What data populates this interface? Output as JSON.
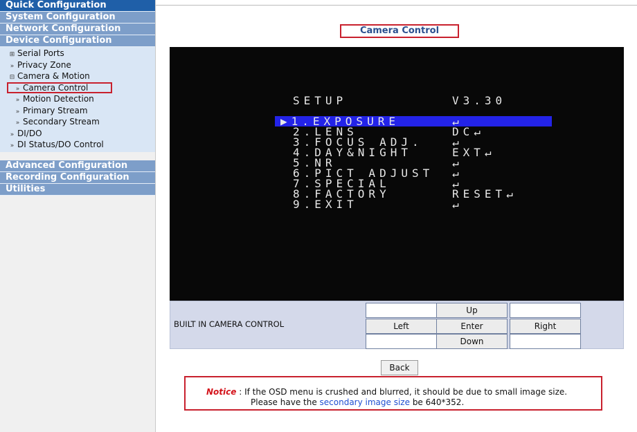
{
  "sidebar": {
    "sections_top": [
      {
        "label": "Quick Configuration"
      },
      {
        "label": "System Configuration"
      },
      {
        "label": "Network Configuration"
      },
      {
        "label": "Device Configuration"
      }
    ],
    "device_items": [
      {
        "label": "Serial Ports",
        "icon": "⊞"
      },
      {
        "label": "Privacy Zone",
        "icon": "»"
      },
      {
        "label": "Camera & Motion",
        "icon": "⊟"
      },
      {
        "label": "Camera Control",
        "icon": "»"
      },
      {
        "label": "Motion Detection",
        "icon": "»"
      },
      {
        "label": "Primary Stream",
        "icon": "»"
      },
      {
        "label": "Secondary Stream",
        "icon": "»"
      },
      {
        "label": "DI/DO",
        "icon": "»"
      },
      {
        "label": "DI Status/DO Control",
        "icon": "»"
      }
    ],
    "sections_bottom": [
      {
        "label": "Advanced Configuration"
      },
      {
        "label": "Recording Configuration"
      },
      {
        "label": "Utilities"
      }
    ]
  },
  "main": {
    "title": "Camera Control",
    "osd": {
      "setup": "SETUP",
      "version": "V3.30",
      "menu": [
        {
          "label": "▶1.EXPOSURE",
          "value": "↵"
        },
        {
          "label": "2.LENS",
          "value": "DC↵"
        },
        {
          "label": "3.FOCUS ADJ.",
          "value": "↵"
        },
        {
          "label": "4.DAY&NIGHT",
          "value": "EXT↵"
        },
        {
          "label": "5.NR",
          "value": "↵"
        },
        {
          "label": "6.PICT ADJUST",
          "value": "↵"
        },
        {
          "label": "7.SPECIAL",
          "value": "↵"
        },
        {
          "label": "8.FACTORY",
          "value": "RESET↵"
        },
        {
          "label": "9.EXIT",
          "value": "↵"
        }
      ]
    },
    "control": {
      "label": "BUILT IN CAMERA CONTROL",
      "up": "Up",
      "left": "Left",
      "enter": "Enter",
      "right": "Right",
      "down": "Down"
    },
    "back": "Back",
    "notice": {
      "label": "Notice",
      "sep": " : ",
      "line1_text": "If the OSD menu is crushed and blurred, it should be due to small image size.",
      "line2_pre": "Please have the ",
      "line2_link": "secondary image size",
      "line2_post": " be 640*352."
    }
  }
}
